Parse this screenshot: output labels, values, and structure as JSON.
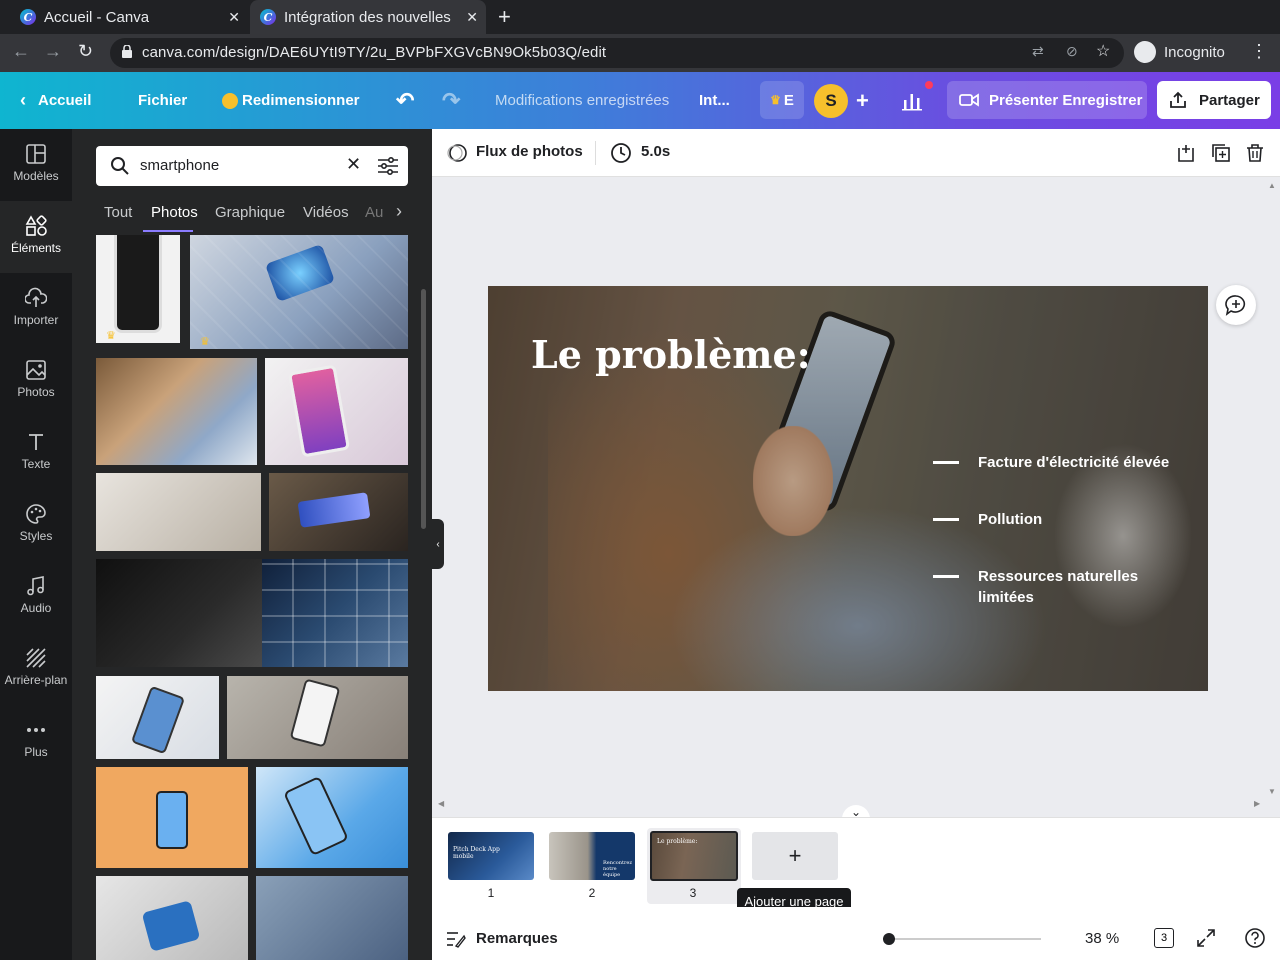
{
  "browser": {
    "tabs": [
      {
        "title": "Accueil - Canva",
        "active": false
      },
      {
        "title": "Intégration des nouvelles r",
        "active": true
      }
    ],
    "url": "canva.com/design/DAE6UYtI9TY/2u_BVPbFXGVcBN9Ok5b03Q/edit",
    "profile_label": "Incognito"
  },
  "header": {
    "home": "Accueil",
    "file": "Fichier",
    "resize": "Redimensionner",
    "save_status": "Modifications enregistrées",
    "doc_title": "Int...",
    "premium_letter": "E",
    "avatar_letter": "S",
    "present": "Présenter Enregistrer",
    "share": "Partager"
  },
  "rail": {
    "items": [
      {
        "label": "Modèles",
        "icon": "templates-icon"
      },
      {
        "label": "Éléments",
        "icon": "elements-icon"
      },
      {
        "label": "Importer",
        "icon": "upload-icon"
      },
      {
        "label": "Photos",
        "icon": "photos-icon"
      },
      {
        "label": "Texte",
        "icon": "text-icon"
      },
      {
        "label": "Styles",
        "icon": "palette-icon"
      },
      {
        "label": "Audio",
        "icon": "music-icon"
      },
      {
        "label": "Arrière-plan",
        "icon": "background-icon"
      },
      {
        "label": "Plus",
        "icon": "more-icon"
      }
    ],
    "active": "Éléments"
  },
  "panel": {
    "search_value": "smartphone",
    "tabs": [
      "Tout",
      "Photos",
      "Graphique",
      "Vidéos",
      "Au"
    ],
    "active_tab": "Photos"
  },
  "editor": {
    "animation": "Flux de photos",
    "duration": "5.0s",
    "slide": {
      "title": "Le problème:",
      "bullets": [
        "Facture d'électricité élevée",
        "Pollution",
        "Ressources naturelles limitées"
      ]
    },
    "pages": [
      {
        "number": "1",
        "caption": "Pitch Deck App mobile"
      },
      {
        "number": "2",
        "caption": "Rencontrez notre équipe"
      },
      {
        "number": "3",
        "caption": "Le problème:"
      }
    ],
    "add_page_tooltip": "Ajouter une page",
    "notes": "Remarques",
    "zoom": "38 %",
    "page_count": "3",
    "zoom_level": 0.04
  },
  "colors": {
    "header_start": "#0fb5d0",
    "header_end": "#7a3ee6",
    "accent": "#8b7cff",
    "avatar": "#f7c02c"
  }
}
